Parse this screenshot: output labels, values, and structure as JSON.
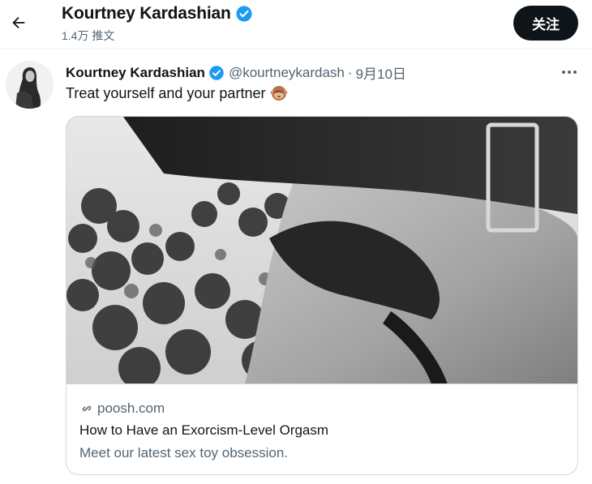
{
  "header": {
    "name": "Kourtney Kardashian",
    "tweet_count": "1.4万 推文",
    "follow_label": "关注",
    "back_icon": "arrow-left-icon",
    "verified_icon": "verified-badge-icon"
  },
  "tweet": {
    "author_name": "Kourtney Kardashian",
    "handle": "@kourtneykardash",
    "separator": "·",
    "date": "9月10日",
    "text": "Treat yourself and your partner",
    "emoji": "🙈",
    "more_icon": "more-horizontal-icon"
  },
  "card": {
    "domain": "poosh.com",
    "link_icon": "link-icon",
    "title": "How to Have an Exorcism-Level Orgasm",
    "description": "Meet our latest sex toy obsession."
  },
  "colors": {
    "verified": "#1d9bf0",
    "primary_text": "#0f1419",
    "secondary_text": "#536471",
    "follow_button_bg": "#0f1419",
    "border": "#cfd9de"
  }
}
